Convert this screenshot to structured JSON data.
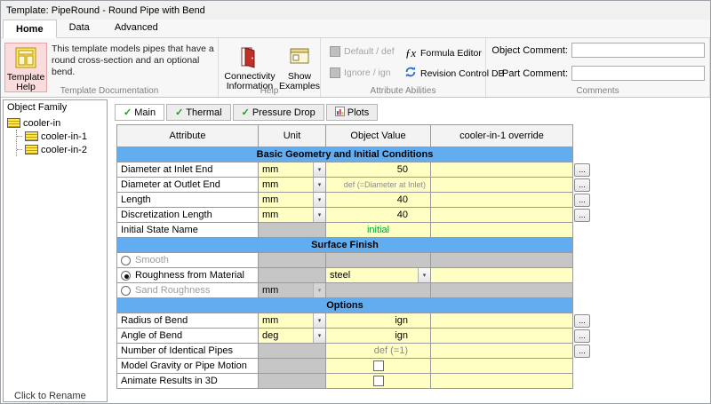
{
  "window": {
    "title": "Template: PipeRound - Round Pipe with Bend"
  },
  "ribbon": {
    "tabs": [
      {
        "label": "Home"
      },
      {
        "label": "Data"
      },
      {
        "label": "Advanced"
      }
    ],
    "template_documentation": {
      "group_label": "Template Documentation",
      "description": "This template models pipes that have a round cross-section and an optional bend.",
      "help_button": "Template Help"
    },
    "help": {
      "group_label": "Help",
      "connectivity_button": "Connectivity Information",
      "examples_button": "Show Examples"
    },
    "attribute_abilities": {
      "group_label": "Attribute Abilities",
      "default_item": "Default / def",
      "ignore_item": "Ignore / ign",
      "formula_item": "Formula Editor",
      "formula_icon_glyph": "ƒx",
      "revision_item": "Revision Control DB"
    },
    "comments": {
      "group_label": "Comments",
      "object_label": "Object Comment:",
      "part_label": "Part Comment:",
      "object_value": "",
      "part_value": ""
    }
  },
  "object_family": {
    "title": "Object Family",
    "root": "cooler-in",
    "children": [
      "cooler-in-1",
      "cooler-in-2"
    ],
    "footer": "Click to Rename"
  },
  "editor": {
    "tabs": [
      {
        "label": "Main"
      },
      {
        "label": "Thermal"
      },
      {
        "label": "Pressure Drop"
      },
      {
        "label": "Plots"
      }
    ],
    "columns": [
      "Attribute",
      "Unit",
      "Object Value",
      "cooler-in-1 override"
    ],
    "colors": {
      "editable_cell": "#ffffc4",
      "disabled_cell": "#c6c6c6",
      "section_header": "#62adf0",
      "green_value": "#00a33e"
    },
    "rows": [
      {
        "t": "sec",
        "label": "Basic Geometry and Initial Conditions"
      },
      {
        "t": "row",
        "label": "Diameter at Inlet End",
        "unit": "mm",
        "unitKind": "combo",
        "value": "50",
        "valueKind": "num",
        "override": "yellow",
        "btn": true
      },
      {
        "t": "row",
        "label": "Diameter at Outlet End",
        "unit": "mm",
        "unitKind": "combo",
        "value": "def (=Diameter at Inlet)",
        "valueKind": "def",
        "override": "yellow",
        "btn": true
      },
      {
        "t": "row",
        "label": "Length",
        "unit": "mm",
        "unitKind": "combo",
        "value": "40",
        "valueKind": "num",
        "override": "yellow",
        "btn": true
      },
      {
        "t": "row",
        "label": "Discretization Length",
        "unit": "mm",
        "unitKind": "combo",
        "value": "40",
        "valueKind": "num",
        "override": "yellow",
        "btn": true
      },
      {
        "t": "row",
        "label": "Initial State Name",
        "unitKind": "gray",
        "value": "initial",
        "valueKind": "green",
        "override": "yellow",
        "btn": false
      },
      {
        "t": "sec",
        "label": "Surface Finish"
      },
      {
        "t": "row",
        "label": "Smooth",
        "radio": "off",
        "disabled": true,
        "unitKind": "gray",
        "valueKind": "gray",
        "override": "gray",
        "btn": false
      },
      {
        "t": "row",
        "label": "Roughness from Material",
        "radio": "on",
        "unitKind": "gray",
        "value": "steel",
        "valueKind": "combo",
        "override": "yellow",
        "btn": false
      },
      {
        "t": "row",
        "label": "Sand Roughness",
        "radio": "off",
        "disabled": true,
        "unit": "mm",
        "unitKind": "combo-dis",
        "valueKind": "gray",
        "override": "gray",
        "btn": false
      },
      {
        "t": "sec",
        "label": "Options"
      },
      {
        "t": "row",
        "label": "Radius of Bend",
        "unit": "mm",
        "unitKind": "combo",
        "value": "ign",
        "valueKind": "num",
        "override": "yellow",
        "btn": true
      },
      {
        "t": "row",
        "label": "Angle of Bend",
        "unit": "deg",
        "unitKind": "combo",
        "value": "ign",
        "valueKind": "num",
        "override": "yellow",
        "btn": true
      },
      {
        "t": "row",
        "label": "Number of Identical Pipes",
        "unitKind": "gray",
        "value": "def (=1)",
        "valueKind": "def",
        "override": "yellow",
        "btn": true
      },
      {
        "t": "row",
        "label": "Model Gravity or Pipe Motion",
        "unitKind": "gray",
        "valueKind": "check",
        "override": "yellow",
        "btn": false
      },
      {
        "t": "row",
        "label": "Animate Results in 3D",
        "unitKind": "gray",
        "valueKind": "check",
        "override": "yellow",
        "btn": false
      }
    ]
  }
}
